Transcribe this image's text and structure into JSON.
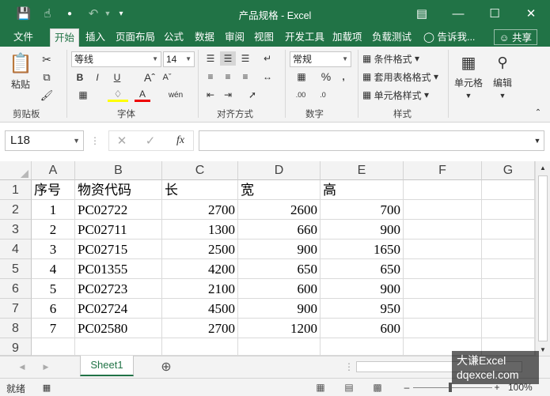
{
  "window": {
    "title": "产品规格 - Excel"
  },
  "tabs": [
    {
      "label": "文件"
    },
    {
      "label": "开始"
    },
    {
      "label": "插入"
    },
    {
      "label": "页面布局"
    },
    {
      "label": "公式"
    },
    {
      "label": "数据"
    },
    {
      "label": "审阅"
    },
    {
      "label": "视图"
    },
    {
      "label": "开发工具"
    },
    {
      "label": "加载项"
    },
    {
      "label": "负载测试"
    },
    {
      "label": "告诉我..."
    }
  ],
  "share_label": "共享",
  "ribbon": {
    "clipboard": {
      "paste_label": "粘贴",
      "group_label": "剪贴板"
    },
    "font": {
      "name": "等线",
      "size": "14",
      "group_label": "字体"
    },
    "alignment": {
      "group_label": "对齐方式"
    },
    "number": {
      "format": "常规",
      "group_label": "数字"
    },
    "styles": {
      "conditional": "条件格式",
      "table": "套用表格格式",
      "cell": "单元格样式",
      "group_label": "样式"
    },
    "cells": {
      "label": "单元格"
    },
    "editing": {
      "label": "编辑"
    }
  },
  "formula_bar": {
    "name_box": "L18",
    "fx": "fx",
    "value": ""
  },
  "columns": [
    "A",
    "B",
    "C",
    "D",
    "E",
    "F",
    "G"
  ],
  "rows": [
    "1",
    "2",
    "3",
    "4",
    "5",
    "6",
    "7",
    "8",
    "9"
  ],
  "table": {
    "headers": [
      "序号",
      "物资代码",
      "长",
      "宽",
      "高"
    ],
    "data": [
      [
        "1",
        "PC02722",
        "2700",
        "2600",
        "700"
      ],
      [
        "2",
        "PC02711",
        "1300",
        "660",
        "900"
      ],
      [
        "3",
        "PC02715",
        "2500",
        "900",
        "1650"
      ],
      [
        "4",
        "PC01355",
        "4200",
        "650",
        "650"
      ],
      [
        "5",
        "PC02723",
        "2100",
        "600",
        "900"
      ],
      [
        "6",
        "PC02724",
        "4500",
        "900",
        "950"
      ],
      [
        "7",
        "PC02580",
        "2700",
        "1200",
        "600"
      ]
    ]
  },
  "sheet_tabs": [
    {
      "label": "Sheet1"
    }
  ],
  "status": {
    "ready": "就绪",
    "zoom": "100%"
  },
  "watermark": {
    "line1": "大谦Excel",
    "line2": "dqexcel.com"
  },
  "colors": {
    "accent": "#217346"
  }
}
